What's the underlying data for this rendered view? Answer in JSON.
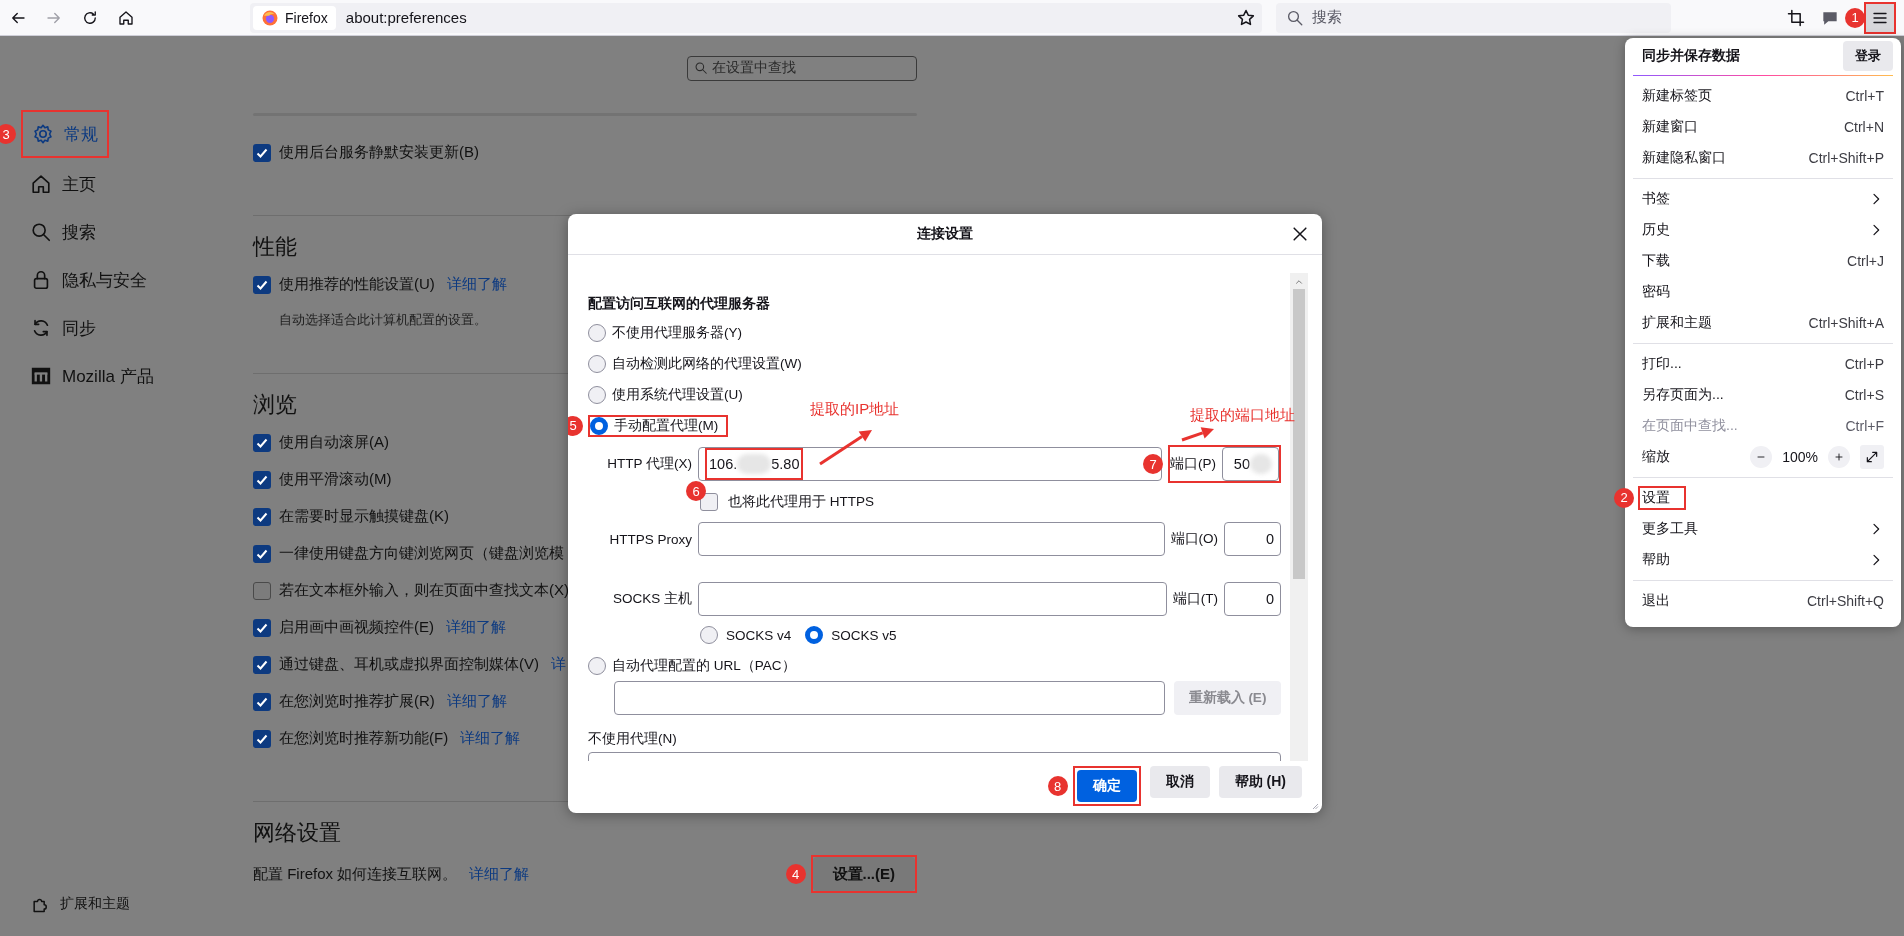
{
  "toolbar": {
    "identity": "Firefox",
    "url": "about:preferences",
    "search_placeholder": "搜索",
    "menu_callout": "1"
  },
  "sidebar": {
    "items": [
      {
        "label": "常规",
        "selected": true,
        "callout": "3"
      },
      {
        "label": "主页",
        "selected": false
      },
      {
        "label": "搜索",
        "selected": false
      },
      {
        "label": "隐私与安全",
        "selected": false
      },
      {
        "label": "同步",
        "selected": false
      },
      {
        "label": "Mozilla 产品",
        "selected": false
      }
    ],
    "footer": [
      {
        "label": "扩展和主题"
      }
    ]
  },
  "search": {
    "placeholder": "在设置中查找"
  },
  "sections": [
    {
      "items": [
        {
          "kind": "checkbox",
          "label": "使用后台服务静默安装更新(B)",
          "checked": true
        }
      ]
    },
    {
      "heading": "性能",
      "items": [
        {
          "kind": "checkbox",
          "label": "使用推荐的性能设置(U)",
          "checked": true,
          "link": "详细了解"
        },
        {
          "kind": "note",
          "text": "自动选择适合此计算机配置的设置。"
        }
      ]
    },
    {
      "heading": "浏览",
      "items": [
        {
          "kind": "checkbox",
          "label": "使用自动滚屏(A)",
          "checked": true
        },
        {
          "kind": "checkbox",
          "label": "使用平滑滚动(M)",
          "checked": true
        },
        {
          "kind": "checkbox",
          "label": "在需要时显示触摸键盘(K)",
          "checked": true
        },
        {
          "kind": "checkbox",
          "label": "一律使用键盘方向键浏览网页（键盘浏览模",
          "checked": true
        },
        {
          "kind": "checkbox",
          "label": "若在文本框外输入，则在页面中查找文本(X)",
          "checked": false
        },
        {
          "kind": "checkbox",
          "label": "启用画中画视频控件(E)",
          "checked": true,
          "link": "详细了解"
        },
        {
          "kind": "checkbox",
          "label": "通过键盘、耳机或虚拟界面控制媒体(V)",
          "checked": true,
          "link": "详"
        },
        {
          "kind": "checkbox",
          "label": "在您浏览时推荐扩展(R)",
          "checked": true,
          "link": "详细了解"
        },
        {
          "kind": "checkbox",
          "label": "在您浏览时推荐新功能(F)",
          "checked": true,
          "link": "详细了解"
        }
      ]
    },
    {
      "heading": "网络设置",
      "items": [
        {
          "kind": "action",
          "text": "配置 Firefox 如何连接互联网。",
          "link": "详细了解",
          "button": "设置...(E)",
          "callout": "4"
        }
      ]
    }
  ],
  "dialog": {
    "title": "连接设置",
    "heading": "配置访问互联网的代理服务器",
    "modes": [
      {
        "label": "不使用代理服务器(Y)",
        "selected": false
      },
      {
        "label": "自动检测此网络的代理设置(W)",
        "selected": false
      },
      {
        "label": "使用系统代理设置(U)",
        "selected": false
      },
      {
        "label": "手动配置代理(M)",
        "selected": true,
        "callout": "5"
      }
    ],
    "proxies": [
      {
        "label": "HTTP 代理(X)",
        "host": [
          "106.",
          "5.80"
        ],
        "redacted": true,
        "host_callout": "6",
        "port_label": "端口(P)",
        "port": "50",
        "port_callout": "7"
      },
      {
        "label": "HTTPS Proxy",
        "redacted": false,
        "port_label": "端口(O)",
        "port": "0"
      },
      {
        "label": "SOCKS 主机",
        "redacted": false,
        "port_label": "端口(T)",
        "port": "0"
      }
    ],
    "share_https": {
      "label": "也将此代理用于 HTTPS",
      "checked": false
    },
    "socks_versions": [
      {
        "label": "SOCKS v4",
        "selected": false
      },
      {
        "label": "SOCKS v5",
        "selected": true
      }
    ],
    "pac": {
      "label": "自动代理配置的 URL（PAC）",
      "selected": false,
      "reload": "重新载入 (E)",
      "reload_disabled": true
    },
    "no_proxy_label": "不使用代理(N)",
    "buttons": [
      {
        "label": "确定",
        "kind": "primary",
        "callout": "8"
      },
      {
        "label": "取消",
        "kind": "normal"
      },
      {
        "label": "帮助 (H)",
        "kind": "normal"
      }
    ],
    "annotations": [
      {
        "text": "提取的IP地址"
      },
      {
        "text": "提取的端口地址"
      }
    ]
  },
  "app_menu": {
    "header": "同步并保存数据",
    "sign_in": "登录",
    "sections": [
      {
        "items": [
          {
            "label": "新建标签页",
            "kind": "shortcut",
            "shortcut": "Ctrl+T",
            "disabled": false
          },
          {
            "label": "新建窗口",
            "kind": "shortcut",
            "shortcut": "Ctrl+N",
            "disabled": false
          },
          {
            "label": "新建隐私窗口",
            "kind": "shortcut",
            "shortcut": "Ctrl+Shift+P",
            "disabled": false
          }
        ]
      },
      {
        "items": [
          {
            "label": "书签",
            "kind": "submenu",
            "disabled": false
          },
          {
            "label": "历史",
            "kind": "submenu",
            "disabled": false
          },
          {
            "label": "下载",
            "kind": "shortcut",
            "shortcut": "Ctrl+J",
            "disabled": false
          },
          {
            "label": "密码",
            "kind": "plain",
            "disabled": false
          },
          {
            "label": "扩展和主题",
            "kind": "shortcut",
            "shortcut": "Ctrl+Shift+A",
            "disabled": false
          }
        ]
      },
      {
        "items": [
          {
            "label": "打印...",
            "kind": "shortcut",
            "shortcut": "Ctrl+P",
            "disabled": false
          },
          {
            "label": "另存页面为...",
            "kind": "shortcut",
            "shortcut": "Ctrl+S",
            "disabled": false
          },
          {
            "label": "在页面中查找...",
            "kind": "shortcut",
            "shortcut": "Ctrl+F",
            "disabled": true
          },
          {
            "label": "缩放",
            "kind": "zoom",
            "zoom": "100%",
            "disabled": false
          }
        ]
      },
      {
        "items": [
          {
            "label": "设置",
            "kind": "plain",
            "disabled": false,
            "callout": "2"
          },
          {
            "label": "更多工具",
            "kind": "submenu",
            "disabled": false
          },
          {
            "label": "帮助",
            "kind": "submenu",
            "disabled": false
          }
        ]
      },
      {
        "items": [
          {
            "label": "退出",
            "kind": "shortcut",
            "shortcut": "Ctrl+Shift+Q",
            "disabled": false
          }
        ]
      }
    ]
  }
}
